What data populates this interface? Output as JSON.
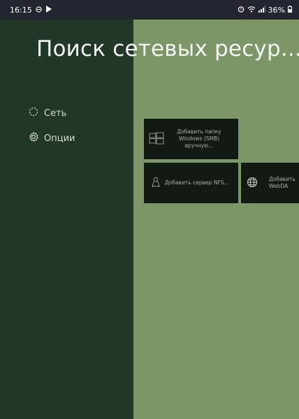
{
  "status_bar": {
    "time": "16:15",
    "battery": "36%",
    "icons_left": [
      "do-not-disturb-icon",
      "play-icon"
    ],
    "icons_right": [
      "alarm-icon",
      "wifi-icon",
      "signal-icon",
      "battery-icon"
    ]
  },
  "page": {
    "title": "Поиск сетевых ресур..."
  },
  "nav": {
    "items": [
      {
        "label": "Сеть",
        "icon": "network-icon"
      },
      {
        "label": "Опции",
        "icon": "gear-icon"
      }
    ]
  },
  "tiles": [
    {
      "label": "Добавить папку Windows (SMB) вручную...",
      "icon": "windows-icon"
    },
    {
      "label": "Добавить сервер NFS...",
      "icon": "linux-icon"
    },
    {
      "label": "Добавить WebDA",
      "icon": "globe-icon"
    }
  ],
  "colors": {
    "background": "#7d9668",
    "panel": "#213728",
    "tile": "#121a13",
    "status_bar": "#232630"
  }
}
